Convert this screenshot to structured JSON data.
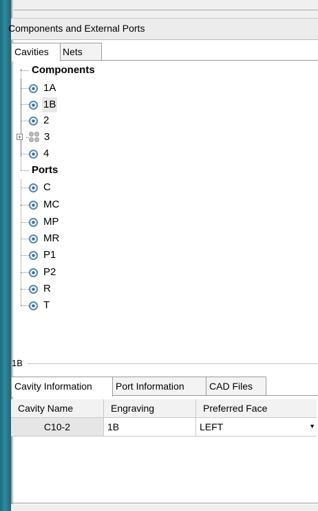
{
  "panel": {
    "title": "Components and External Ports"
  },
  "top_tabs": [
    "Cavities",
    "Nets"
  ],
  "tree": {
    "components_label": "Components",
    "components": [
      "1A",
      "1B",
      "2",
      "3",
      "4"
    ],
    "ports_label": "Ports",
    "ports": [
      "C",
      "MC",
      "MP",
      "MR",
      "P1",
      "P2",
      "R",
      "T"
    ],
    "selected": "1B"
  },
  "details": {
    "section_label": "1B",
    "tabs": [
      "Cavity Information",
      "Port Information",
      "CAD Files"
    ],
    "grid": {
      "headers": [
        "Cavity Name",
        "Engraving",
        "Preferred Face"
      ],
      "rows": [
        {
          "cavity_name": "C10-2",
          "engraving": "1B",
          "preferred_face": "LEFT"
        }
      ]
    }
  }
}
